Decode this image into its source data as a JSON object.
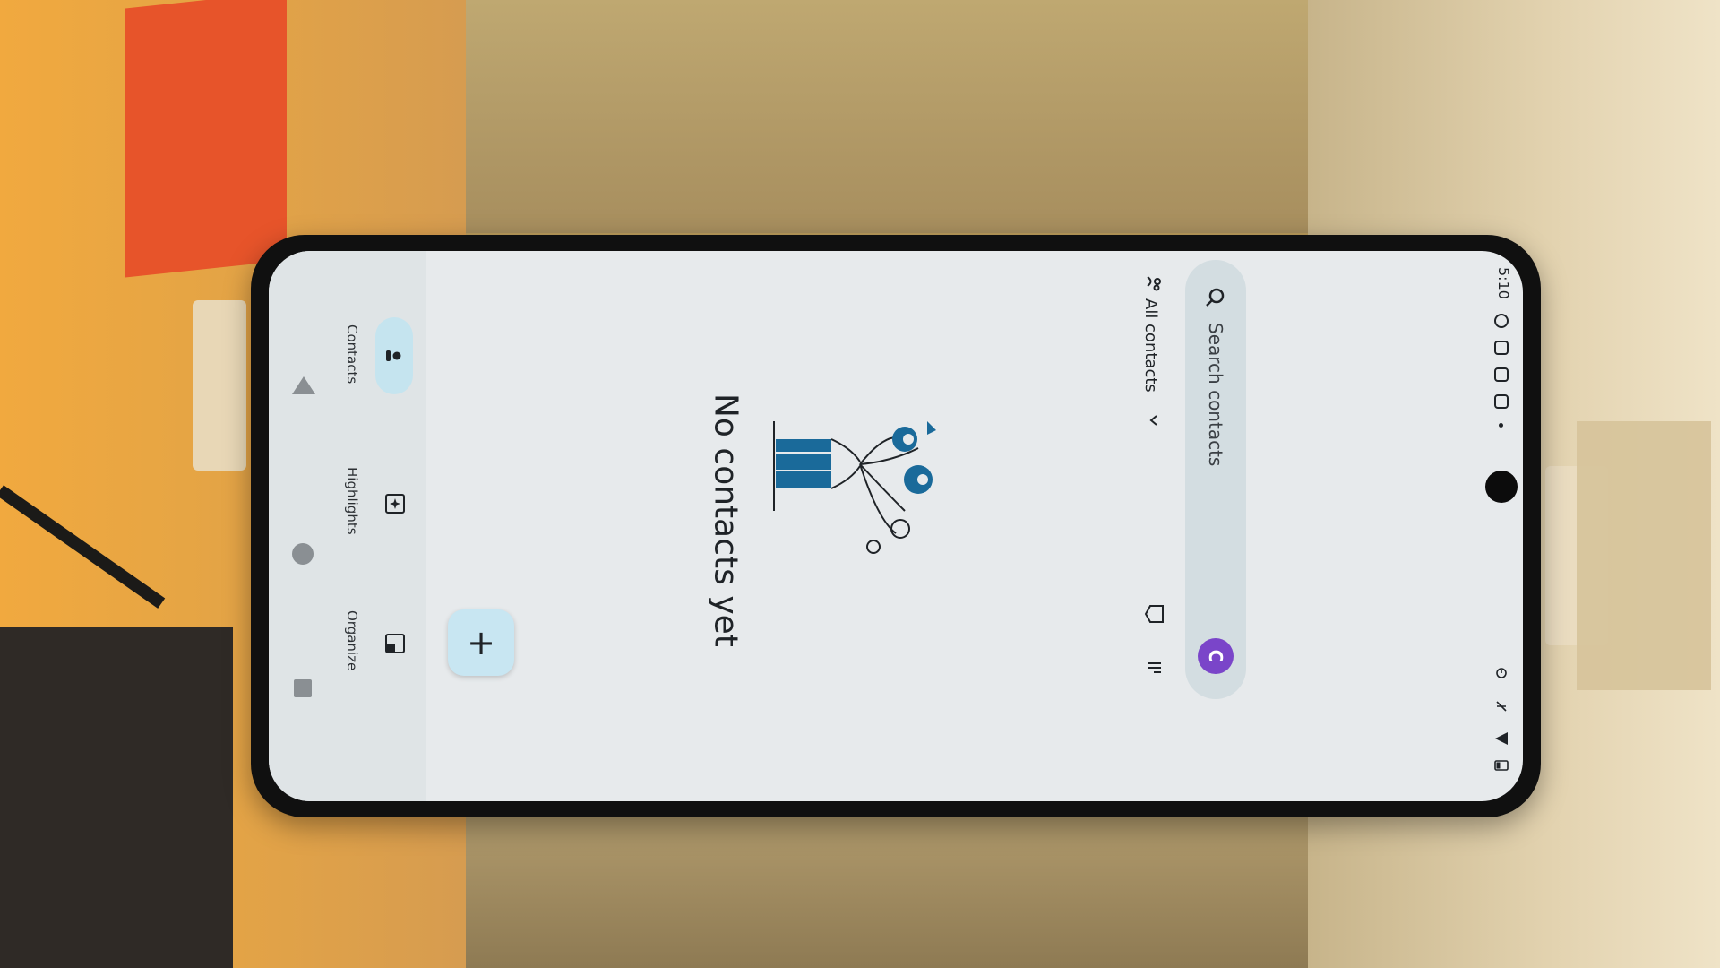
{
  "status_bar": {
    "time": "5:10"
  },
  "search": {
    "placeholder": "Search contacts",
    "avatar_letter": "C"
  },
  "filter": {
    "label": "All contacts"
  },
  "empty_state": {
    "message": "No contacts yet"
  },
  "bottom_nav": {
    "items": [
      {
        "label": "Contacts",
        "icon": "person-icon",
        "active": true
      },
      {
        "label": "Highlights",
        "icon": "highlights-icon",
        "active": false
      },
      {
        "label": "Organize",
        "icon": "organize-icon",
        "active": false
      }
    ]
  },
  "fab": {
    "symbol": "+"
  },
  "colors": {
    "screen_bg": "#e7eaec",
    "search_bg": "#d3dde1",
    "active_pill": "#c5e4ef",
    "fab_bg": "#c8e6f2",
    "avatar_bg": "#7a45c9",
    "illustration_blue": "#1a6a9a"
  }
}
